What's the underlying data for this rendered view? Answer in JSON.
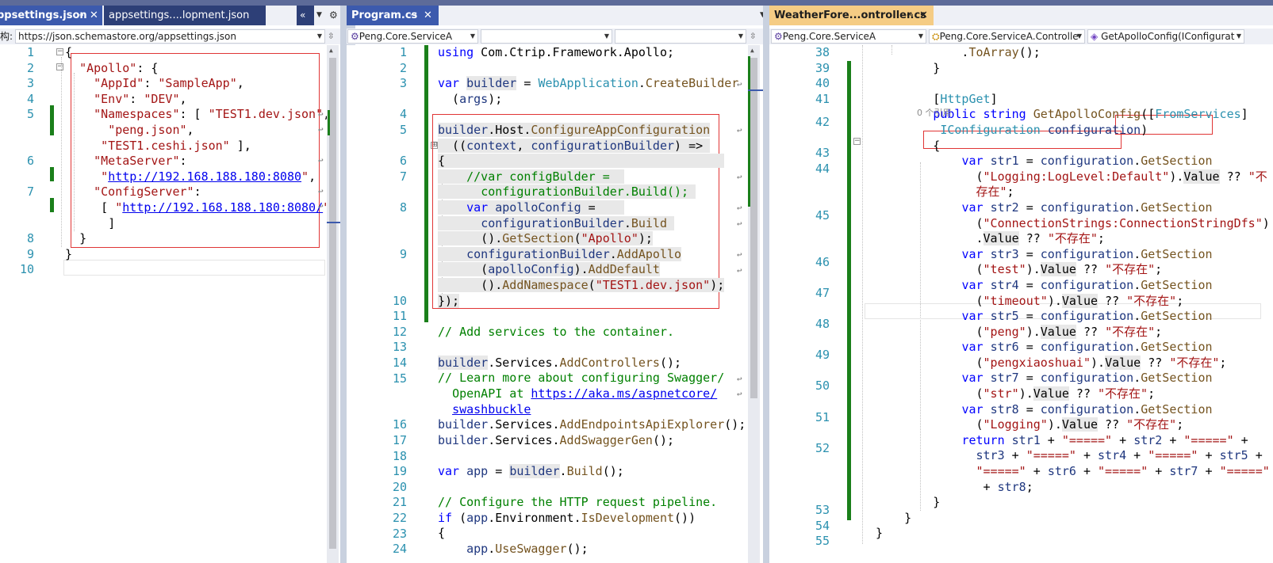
{
  "left": {
    "tabs": [
      "ppsettings.json",
      "appsettings....lopment.json"
    ],
    "schema_label": "构:",
    "schema_url": "https://json.schemastore.org/appsettings.json",
    "lines": [
      "1",
      "2",
      "3",
      "4",
      "5",
      "6",
      "7",
      "8",
      "9",
      "10"
    ],
    "json": {
      "open": "{",
      "apollo_key": "\"Apollo\"",
      "apollo_rest": ": {",
      "appid_key": "\"AppId\"",
      "appid_val": "\"SampleApp\"",
      "env_key": "\"Env\"",
      "env_val": "\"DEV\"",
      "ns_key": "\"Namespaces\"",
      "ns_open": ": [ ",
      "ns_1": "\"TEST1.dev.json\"",
      "ns_2": "\"peng.json\"",
      "ns_3": "\"TEST1.ceshi.json\"",
      "ns_close": " ],",
      "meta_key": "\"MetaServer\"",
      "q": "\"",
      "meta_url": "http://192.168.188.180:8080",
      "cfg_key": "\"ConfigServer\"",
      "cfg_open": "[ ",
      "cfg_url": "http://192.168.188.180:8080/",
      "cfg_close": "]",
      "close_inner": "}",
      "close_outer": "}"
    }
  },
  "middle": {
    "tab": "Program.cs",
    "combo1": "Peng.Core.ServiceA",
    "combo2": "",
    "combo3": "",
    "lines": [
      "1",
      "2",
      "3",
      "4",
      "5",
      "6",
      "7",
      "8",
      "9",
      "10",
      "11",
      "12",
      "13",
      "14",
      "15",
      "16",
      "17",
      "18",
      "19",
      "20",
      "21",
      "22",
      "23",
      "24"
    ],
    "code": {
      "using": "using",
      "using_ns": "Com.Ctrip.Framework.Apollo",
      "var": "var",
      "builder": "builder",
      "webapp": "WebApplication",
      "createbuilder": "CreateBuilder",
      "args": "args",
      "host": "Host",
      "configappcfg": "ConfigureAppConfiguration",
      "context": "context",
      "cfgbuilder": "configurationBuilder",
      "comment_var": "//var configBulder =",
      "comment_build": "configurationBuilder.Build();",
      "apollocfg": "apolloConfig",
      "build": "Build",
      "getsection": "GetSection",
      "apollo_str": "\"Apollo\"",
      "addapollo": "AddApollo",
      "adddefault": "AddDefault",
      "addnamespace": "AddNamespace",
      "ns_str": "\"TEST1.dev.json\"",
      "comment_add": "// Add services to the container.",
      "services": "Services",
      "addcontrollers": "AddControllers",
      "comment_learn": "// Learn more about configuring Swagger/",
      "comment_openapi": "OpenAPI at ",
      "link": "https://aka.ms/aspnetcore/",
      "link2": "swashbuckle",
      "addendpoints": "AddEndpointsApiExplorer",
      "addswaggergen": "AddSwaggerGen",
      "app": "app",
      "comment_cfg": "// Configure the HTTP request pipeline.",
      "if": "if",
      "environment": "Environment",
      "isdev": "IsDevelopment",
      "useswagger": "UseSwagger"
    }
  },
  "right": {
    "tab": "WeatherFore...ontroller.cs",
    "combo1": "Peng.Core.ServiceA",
    "combo2": "Peng.Core.ServiceA.Controlle",
    "combo3": "GetApolloConfig(IConfigurat",
    "lines": [
      "38",
      "39",
      "40",
      "41",
      "42",
      "43",
      "44",
      "45",
      "46",
      "47",
      "48",
      "49",
      "50",
      "51",
      "52",
      "53",
      "54",
      "55"
    ],
    "refs": "0 个引用",
    "code": {
      "toarray": "ToArray",
      "httpget": "HttpGet",
      "public": "public",
      "string": "string",
      "method": "GetApolloConfig",
      "fromservices": "FromServices",
      "iconfig": "IConfiguration",
      "configuration": "configuration",
      "var": "var",
      "getsection": "GetSection",
      "value": "Value",
      "notexist": "\"不存在\"",
      "notexist_a": "\"不",
      "notexist_b": "存在\"",
      "s1": "str1",
      "s2": "str2",
      "s3": "str3",
      "s4": "str4",
      "s5": "str5",
      "s6": "str6",
      "s7": "str7",
      "s8": "str8",
      "k1": "\"Logging:LogLevel:Default\"",
      "k2": "\"ConnectionStrings:ConnectionStringDfs\"",
      "k3": "\"test\"",
      "k4": "\"timeout\"",
      "k5": "\"peng\"",
      "k6": "\"pengxiaoshuai\"",
      "k7": "\"str\"",
      "k8": "\"Logging\"",
      "return": "return",
      "sep": "\"=====\""
    }
  }
}
